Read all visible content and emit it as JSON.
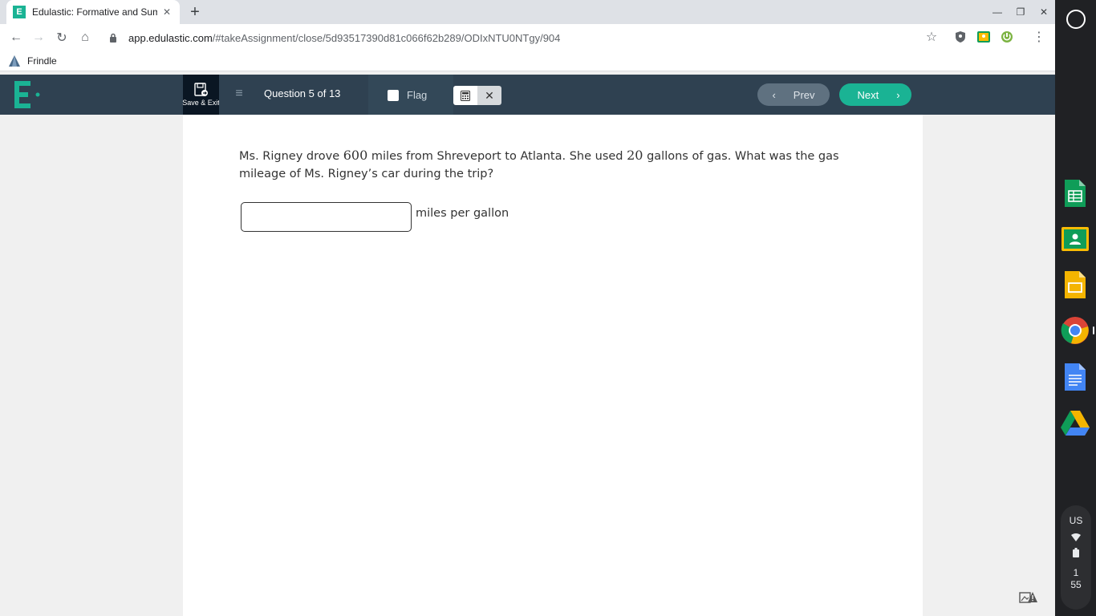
{
  "browser": {
    "tab_title": "Edulastic: Formative and Summ",
    "tab_favicon": "E",
    "url_domain": "app.edulastic.com",
    "url_path": "/#takeAssignment/close/5d93517390d81c066f62b289/ODIxNTU0NTgy/904",
    "bookmark_label": "Frindle"
  },
  "header": {
    "save_exit_label": "Save & Exit",
    "question_label": "Question 5 of 13",
    "flag_label": "Flag",
    "prev_label": "Prev",
    "next_label": "Next"
  },
  "question": {
    "text_part1": "Ms. Rigney drove ",
    "num1": "600",
    "text_part2": " miles from Shreveport to Atlanta. She used ",
    "num2": "20",
    "text_part3": " gallons of gas. What was the gas mileage of Ms. Rigney’s car during the trip?",
    "answer_value": "",
    "unit_label": "miles per gallon"
  },
  "tray": {
    "keyboard": "US",
    "time_hour": "1",
    "time_minute": "55"
  },
  "colors": {
    "brand_green": "#1ab394",
    "header_bg": "#2f4151",
    "prev_bg": "#5f7180"
  }
}
